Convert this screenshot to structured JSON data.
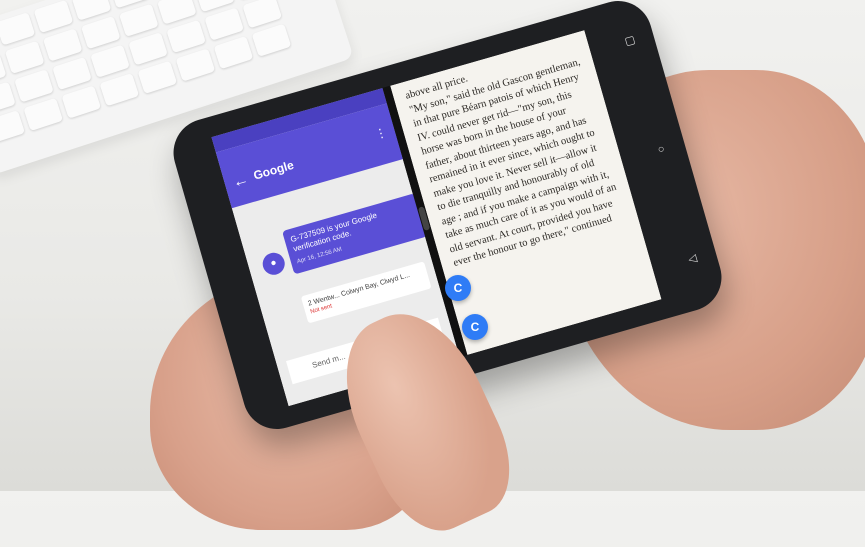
{
  "left_app": {
    "title": "Google",
    "back_icon": "←",
    "more_icon": "⋮",
    "message_text": "G-737509 is your Google verification code.",
    "message_time": "Apr 16, 12:56 AM",
    "address_text": "2 Wentw... Colwyn Bay, Clwyd L...",
    "address_error": "Not sent",
    "compose_placeholder": "Send m..."
  },
  "fab_label": "C",
  "reader_text": [
    "above all price.",
    "\"My son,\" said the old Gascon gentleman, in that pure Béarn patois of which Henry IV. could never get rid—\"my son, this horse was born in the house of your father, about thirteen years ago, and has remained in it ever since, which ought to make you love it. Never sell it—allow it to die tranquilly and honourably of old age ; and if you make a campaign with it, take as much care of it as you would of an old servant. At court, provided you have ever the honour to go there,\" continued"
  ],
  "nav_icons": [
    "recents-icon",
    "home-icon",
    "back-icon"
  ],
  "colors": {
    "app_accent": "#5a4fd6",
    "fab_blue": "#2f7cf6"
  }
}
